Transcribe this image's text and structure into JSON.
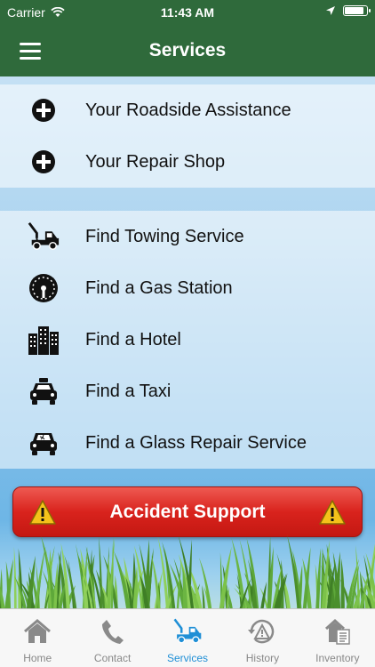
{
  "status_bar": {
    "carrier": "Carrier",
    "time": "11:43 AM",
    "battery_level": 0.86
  },
  "nav": {
    "title": "Services"
  },
  "groups": [
    {
      "items": [
        {
          "label": "Your Roadside Assistance",
          "icon": "plus-circle-icon"
        },
        {
          "label": "Your Repair Shop",
          "icon": "plus-circle-icon"
        }
      ]
    },
    {
      "items": [
        {
          "label": "Find Towing Service",
          "icon": "tow-truck-icon"
        },
        {
          "label": "Find a Gas Station",
          "icon": "fuel-gauge-icon"
        },
        {
          "label": "Find a Hotel",
          "icon": "hotel-buildings-icon"
        },
        {
          "label": "Find a Taxi",
          "icon": "taxi-icon"
        },
        {
          "label": "Find a Glass Repair Service",
          "icon": "car-glass-icon"
        }
      ]
    }
  ],
  "accident_button": {
    "label": "Accident Support",
    "color": "#d9231d"
  },
  "tabs": [
    {
      "label": "Home",
      "icon": "home-icon",
      "active": false
    },
    {
      "label": "Contact",
      "icon": "phone-icon",
      "active": false
    },
    {
      "label": "Services",
      "icon": "tow-truck-icon",
      "active": true
    },
    {
      "label": "History",
      "icon": "history-warning-icon",
      "active": false
    },
    {
      "label": "Inventory",
      "icon": "inventory-icon",
      "active": false
    }
  ],
  "colors": {
    "header": "#2f6a3b",
    "active_tab": "#1f8fd6"
  }
}
